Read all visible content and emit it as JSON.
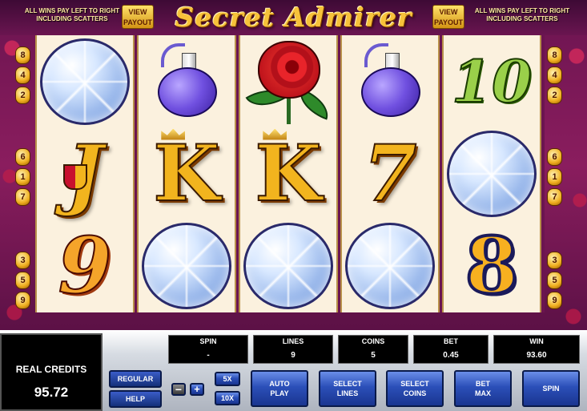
{
  "header": {
    "title": "Secret Admirer",
    "left_note": "ALL WINS PAY LEFT TO RIGHT\nINCLUDING SCATTERS",
    "right_note": "ALL WINS PAY LEFT TO RIGHT\nINCLUDING SCATTERS",
    "view_payout_label": "VIEW\nPAYOUT"
  },
  "paylines": {
    "left": [
      "8",
      "4",
      "2",
      "6",
      "1",
      "7",
      "3",
      "5",
      "9"
    ],
    "right": [
      "8",
      "4",
      "2",
      "6",
      "1",
      "7",
      "3",
      "5",
      "9"
    ]
  },
  "reels": [
    {
      "symbols": [
        "diamond",
        "J",
        "9"
      ]
    },
    {
      "symbols": [
        "perfume",
        "K",
        "diamond"
      ]
    },
    {
      "symbols": [
        "rose",
        "K",
        "diamond"
      ]
    },
    {
      "symbols": [
        "perfume",
        "7",
        "diamond"
      ]
    },
    {
      "symbols": [
        "10",
        "diamond",
        "8"
      ]
    }
  ],
  "credits": {
    "label": "REAL CREDITS",
    "value": "95.72"
  },
  "meters": {
    "spin": {
      "label": "SPIN",
      "value": "-"
    },
    "lines": {
      "label": "LINES",
      "value": "9"
    },
    "coins": {
      "label": "COINS",
      "value": "5"
    },
    "bet": {
      "label": "BET",
      "value": "0.45"
    },
    "win": {
      "label": "WIN",
      "value": "93.60"
    }
  },
  "buttons": {
    "regular": "REGULAR",
    "help": "HELP",
    "minus": "−",
    "plus": "+",
    "five_x": "5X",
    "ten_x": "10X",
    "autoplay": "AUTO\nPLAY",
    "select_lines": "SELECT\nLINES",
    "select_coins": "SELECT\nCOINS",
    "bet_max": "BET\nMAX",
    "spin": "SPIN"
  }
}
